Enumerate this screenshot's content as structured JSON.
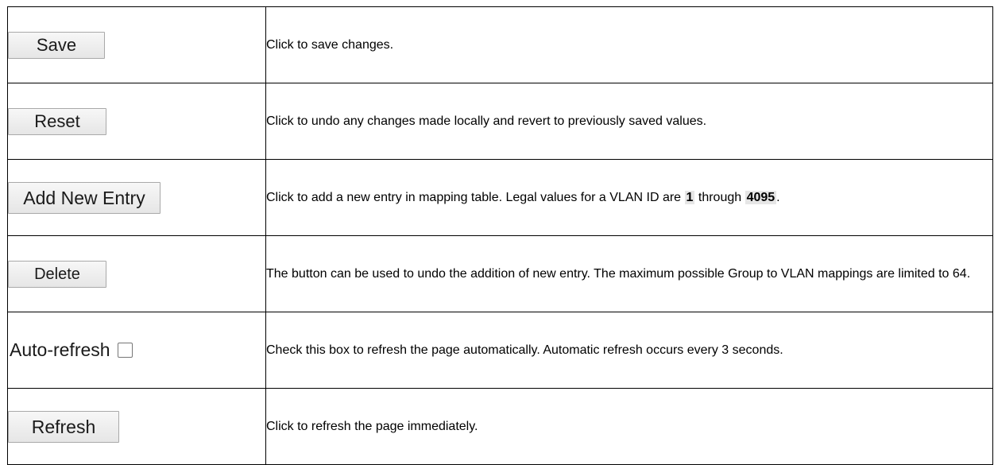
{
  "rows": [
    {
      "control": "Save",
      "description": "Click to save changes."
    },
    {
      "control": "Reset",
      "description": "Click to undo any changes made locally and revert to previously saved values."
    },
    {
      "control": "Add New Entry",
      "description_before": "Click to add a new entry in mapping table. Legal values for a VLAN ID are ",
      "value_min": "1",
      "description_middle": " through ",
      "value_max": "4095",
      "description_after": "."
    },
    {
      "control": "Delete",
      "description": "The button can be used to undo the addition of new entry. The maximum possible Group to VLAN mappings are limited to 64."
    },
    {
      "control": "Auto-refresh",
      "checkbox_checked": false,
      "description": "Check this box to refresh the page automatically. Automatic refresh occurs every 3 seconds."
    },
    {
      "control": "Refresh",
      "description": "Click to refresh the page immediately."
    }
  ]
}
